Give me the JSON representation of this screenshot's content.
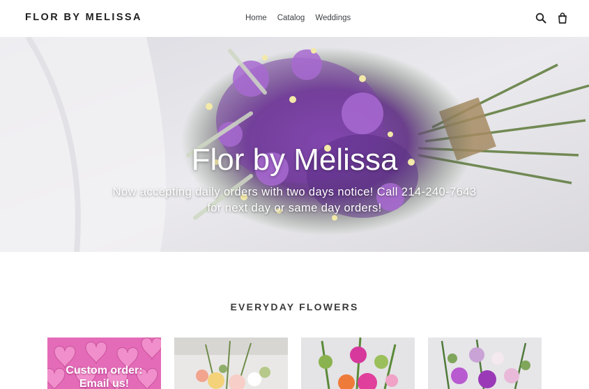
{
  "header": {
    "logo": "FLOR BY MELISSA",
    "nav": [
      {
        "label": "Home"
      },
      {
        "label": "Catalog"
      },
      {
        "label": "Weddings"
      }
    ],
    "icons": [
      "search-icon",
      "cart-icon"
    ]
  },
  "hero": {
    "title": "Flor by Melissa",
    "subtitle_line1": "Now accepting daily orders with two days notice! Call 214-240-7643",
    "subtitle_line2": "for next day or same day orders!"
  },
  "collection": {
    "title": "EVERYDAY FLOWERS",
    "cards": [
      {
        "line1": "Custom order:",
        "line2": "Email us!"
      },
      {
        "line1": "",
        "line2": ""
      },
      {
        "line1": "",
        "line2": ""
      },
      {
        "line1": "",
        "line2": ""
      }
    ]
  },
  "colors": {
    "accent_pink": "#e46bb8",
    "hero_overlay": "#e7e6ea",
    "text_dark": "#1f1f1f"
  }
}
